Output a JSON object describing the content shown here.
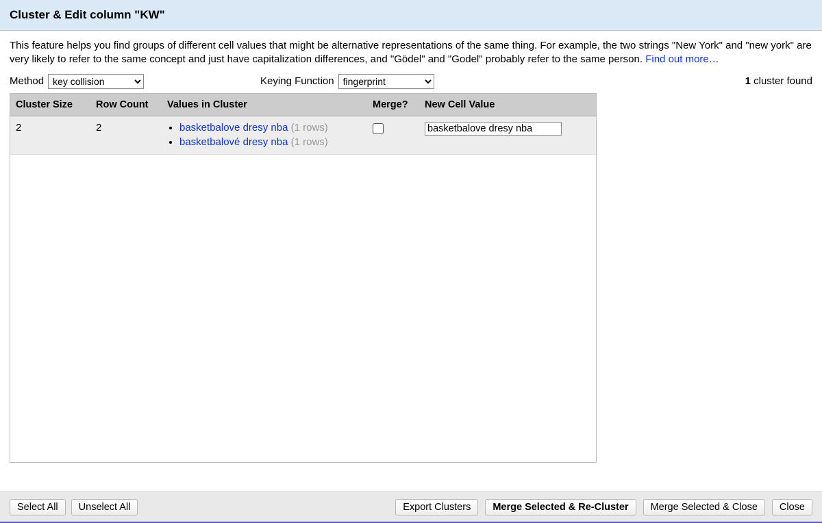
{
  "header": {
    "title": "Cluster & Edit column \"KW\""
  },
  "description": {
    "text": "This feature helps you find groups of different cell values that might be alternative representations of the same thing. For example, the two strings \"New York\" and \"new york\" are very likely to refer to the same concept and just have capitalization differences, and \"Gödel\" and \"Godel\" probably refer to the same person. ",
    "link": "Find out more…"
  },
  "controls": {
    "method_label": "Method",
    "method_value": "key collision",
    "keying_label": "Keying Function",
    "keying_value": "fingerprint",
    "found_count": "1",
    "found_suffix": " cluster found"
  },
  "table": {
    "headers": {
      "size": "Cluster Size",
      "rows": "Row Count",
      "values": "Values in Cluster",
      "merge": "Merge?",
      "newval": "New Cell Value"
    },
    "rows": [
      {
        "size": "2",
        "rowcount": "2",
        "values": [
          {
            "text": "basketbalove dresy nba",
            "count": "(1 rows)"
          },
          {
            "text": "basketbalové dresy nba",
            "count": "(1 rows)"
          }
        ],
        "merge_checked": false,
        "new_value": "basketbalove dresy nba"
      }
    ]
  },
  "footer": {
    "select_all": "Select All",
    "unselect_all": "Unselect All",
    "export": "Export Clusters",
    "merge_recluster": "Merge Selected & Re-Cluster",
    "merge_close": "Merge Selected & Close",
    "close": "Close"
  }
}
